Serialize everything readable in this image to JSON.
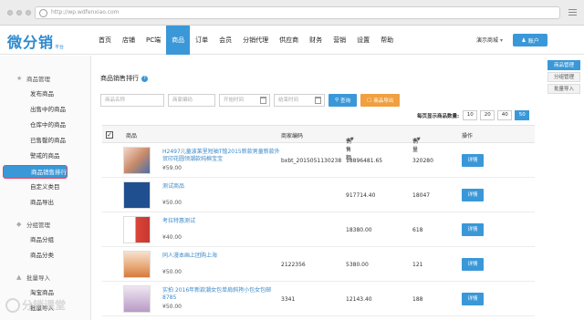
{
  "browser": {
    "url": "http://wp.wdfenxiao.com"
  },
  "logo": {
    "text": "微分销",
    "sub": "平台"
  },
  "nav": [
    {
      "label": "首页"
    },
    {
      "label": "店铺"
    },
    {
      "label": "PC端"
    },
    {
      "label": "商品",
      "active": true
    },
    {
      "label": "订单"
    },
    {
      "label": "会员"
    },
    {
      "label": "分销代理"
    },
    {
      "label": "供应商"
    },
    {
      "label": "财务"
    },
    {
      "label": "营销"
    },
    {
      "label": "设置"
    },
    {
      "label": "帮助"
    }
  ],
  "header": {
    "demo_shop": "演示商城",
    "account": "账户"
  },
  "sidebar": {
    "sections": [
      {
        "title": "商品管理",
        "icon": "star-icon",
        "items": [
          "发布商品",
          "出售中的商品",
          "仓库中的商品",
          "已售罄的商品",
          "警戒的商品",
          "商品销售排行",
          "自定义类目",
          "商品导出"
        ]
      },
      {
        "title": "分组管理",
        "icon": "tag-icon",
        "items": [
          "商品分组",
          "商品分类"
        ]
      },
      {
        "title": "批量导入",
        "icon": "import-icon",
        "items": [
          "淘宝商品",
          "批量导入"
        ]
      }
    ],
    "active_item": "商品销售排行"
  },
  "right_tabs": [
    {
      "label": "商品管理",
      "active": true
    },
    {
      "label": "分组管理"
    },
    {
      "label": "批量导入"
    }
  ],
  "page": {
    "title": "商品销售排行",
    "filters": {
      "name_placeholder": "商品名称",
      "code_placeholder": "商家编码",
      "start_placeholder": "开始时间",
      "end_placeholder": "结束时间"
    },
    "search_label": "查询",
    "export_label": "商品导出",
    "pager_label": "每页显示商品数量:",
    "page_sizes": [
      "10",
      "20",
      "40",
      "50"
    ],
    "page_size_selected": "50"
  },
  "table": {
    "columns": {
      "product": "商品",
      "code": "商家编码",
      "sales_amount": "销售额",
      "sales_qty": "销量",
      "action": "操作"
    },
    "action_label": "详情",
    "rows": [
      {
        "name": "H2497儿童波莱里短袖T恤2015新款男童新款外贸印花圆领潮款纯棉宝宝",
        "price": "¥59.00",
        "code": "bxbt_2015051130238",
        "amount": "18896481.65",
        "qty": "320280"
      },
      {
        "name": "测试商品",
        "price": "¥50.00",
        "code": "",
        "amount": "917714.40",
        "qty": "18047"
      },
      {
        "name": "考拉特惠测试",
        "price": "¥40.00",
        "code": "",
        "amount": "18380.00",
        "qty": "618"
      },
      {
        "name": "同人漫本画上团购上海",
        "price": "¥50.00",
        "code": "2122356",
        "amount": "5380.00",
        "qty": "121"
      },
      {
        "name": "实拍 2016年新款潮女包单肩斜挎小包女包邮8785",
        "price": "¥50.00",
        "code": "3341",
        "amount": "12143.40",
        "qty": "188"
      }
    ]
  },
  "watermark": "分销课堂"
}
